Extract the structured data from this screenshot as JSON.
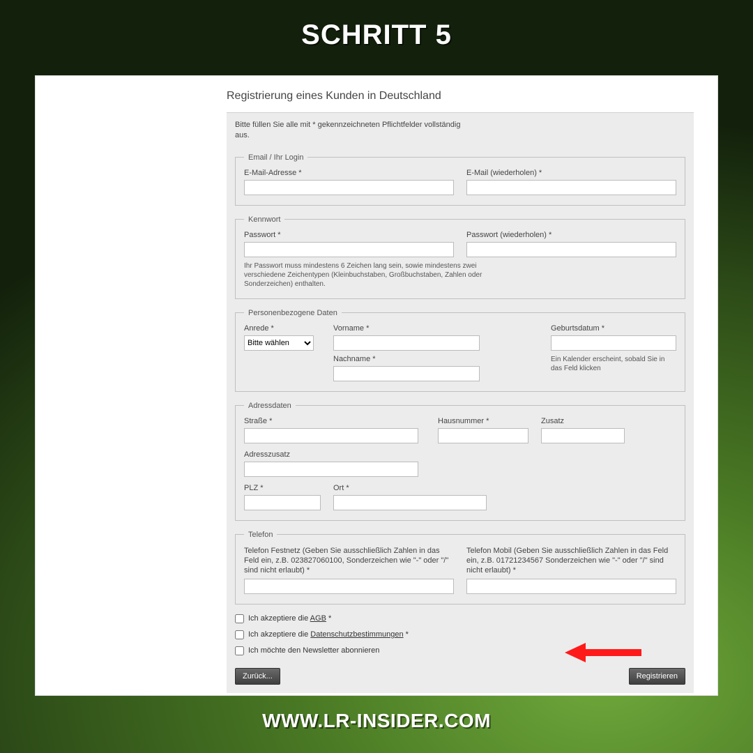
{
  "page": {
    "title": "SCHRITT 5",
    "footer_url": "WWW.LR-INSIDER.COM"
  },
  "form": {
    "heading": "Registrierung eines Kunden in Deutschland",
    "intro": "Bitte füllen Sie alle mit * gekennzeichneten Pflichtfelder vollständig aus.",
    "groups": {
      "login": {
        "legend": "Email / Ihr Login",
        "email_label": "E-Mail-Adresse *",
        "email_repeat_label": "E-Mail (wiederholen) *"
      },
      "password": {
        "legend": "Kennwort",
        "password_label": "Passwort *",
        "password_repeat_label": "Passwort (wiederholen) *",
        "hint": "Ihr Passwort muss mindestens 6 Zeichen lang sein, sowie mindestens zwei verschiedene Zeichentypen (Kleinbuchstaben, Großbuchstaben, Zahlen oder Sonderzeichen) enthalten."
      },
      "personal": {
        "legend": "Personenbezogene Daten",
        "salutation_label": "Anrede *",
        "salutation_value": "Bitte wählen",
        "firstname_label": "Vorname *",
        "lastname_label": "Nachname *",
        "dob_label": "Geburtsdatum *",
        "dob_hint": "Ein Kalender erscheint, sobald Sie in das Feld klicken"
      },
      "address": {
        "legend": "Adressdaten",
        "street_label": "Straße *",
        "houseno_label": "Hausnummer *",
        "addition_label": "Zusatz",
        "addr_addition_label": "Adresszusatz",
        "zip_label": "PLZ *",
        "city_label": "Ort *"
      },
      "phone": {
        "legend": "Telefon",
        "landline_label": "Telefon Festnetz (Geben Sie ausschließlich Zahlen in das Feld ein, z.B. 023827060100, Sonderzeichen wie \"-\" oder \"/\" sind nicht erlaubt) *",
        "mobile_label": "Telefon Mobil (Geben Sie ausschließlich Zahlen in das Feld ein, z.B. 01721234567 Sonderzeichen wie \"-\" oder \"/\" sind nicht erlaubt) *"
      }
    },
    "consents": {
      "agb_prefix": "Ich akzeptiere die ",
      "agb_link": "AGB",
      "agb_suffix": " *",
      "privacy_prefix": "Ich akzeptiere die ",
      "privacy_link": "Datenschutzbestimmungen",
      "privacy_suffix": " *",
      "newsletter_label": "Ich möchte den Newsletter abonnieren"
    },
    "buttons": {
      "back": "Zurück...",
      "register": "Registrieren"
    }
  },
  "arrow": {
    "color": "#ff1a1a"
  }
}
